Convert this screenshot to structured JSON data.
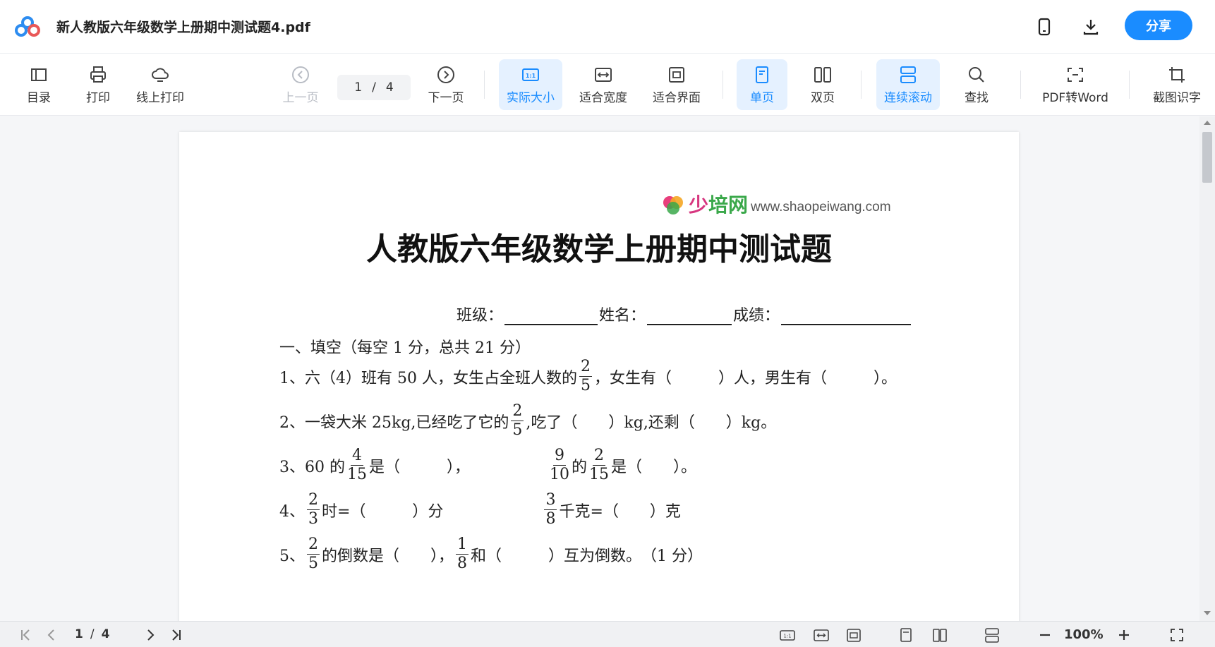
{
  "app": {
    "file_title": "新人教版六年级数学上册期中测试题4.pdf",
    "share_label": "分享",
    "accent": "#1a8cff"
  },
  "toolbar": {
    "toc": "目录",
    "print": "打印",
    "online_print": "线上打印",
    "prev_page": "上一页",
    "next_page": "下一页",
    "current_page": "1",
    "separator": "/",
    "total_pages": "4",
    "actual_size": "实际大小",
    "fit_width": "适合宽度",
    "fit_screen": "适合界面",
    "single_page": "单页",
    "double_page": "双页",
    "continuous_scroll": "连续滚动",
    "find": "查找",
    "pdf_to_word": "PDF转Word",
    "screenshot_ocr": "截图识字"
  },
  "document": {
    "brand_cn_a": "少",
    "brand_cn_b": "培网",
    "brand_url": "www.shaopeiwang.com",
    "title": "人教版六年级数学上册期中测试题",
    "class_label": "班级：",
    "name_label": "姓名：",
    "score_label": "成绩：",
    "section1": "一、填空（每空 1 分，总共 21 分）",
    "q1_a": "1、六（4）班有 50 人，女生占全班人数的",
    "q1_num": "2",
    "q1_den": "5",
    "q1_b": "，女生有（　　　）人，男生有（　　　）。",
    "q2_a": "2、一袋大米 25kg,已经吃了它的",
    "q2_num": "2",
    "q2_den": "5",
    "q2_b": ",吃了（　　）kg,还剩（　　）kg。",
    "q3_a": "3、60 的",
    "q3_num": "4",
    "q3_den": "15",
    "q3_b": "是（　　　），",
    "q3_c_num": "9",
    "q3_c_den": "10",
    "q3_d": "的",
    "q3_d_num": "2",
    "q3_d_den": "15",
    "q3_e": "是（　　）。",
    "q4_a": "4、",
    "q4_num": "2",
    "q4_den": "3",
    "q4_b": "时=（　　　）分",
    "q4_c_num": "3",
    "q4_c_den": "8",
    "q4_d": "千克=（　　）克",
    "q5_a": "5、",
    "q5_num": "2",
    "q5_den": "5",
    "q5_b": "的倒数是（　　），",
    "q5_c_num": "1",
    "q5_c_den": "8",
    "q5_d": "和（　　　）互为倒数。　（1 分）"
  },
  "statusbar": {
    "current_page": "1",
    "separator": "/",
    "total_pages": "4",
    "zoom": "100%"
  }
}
